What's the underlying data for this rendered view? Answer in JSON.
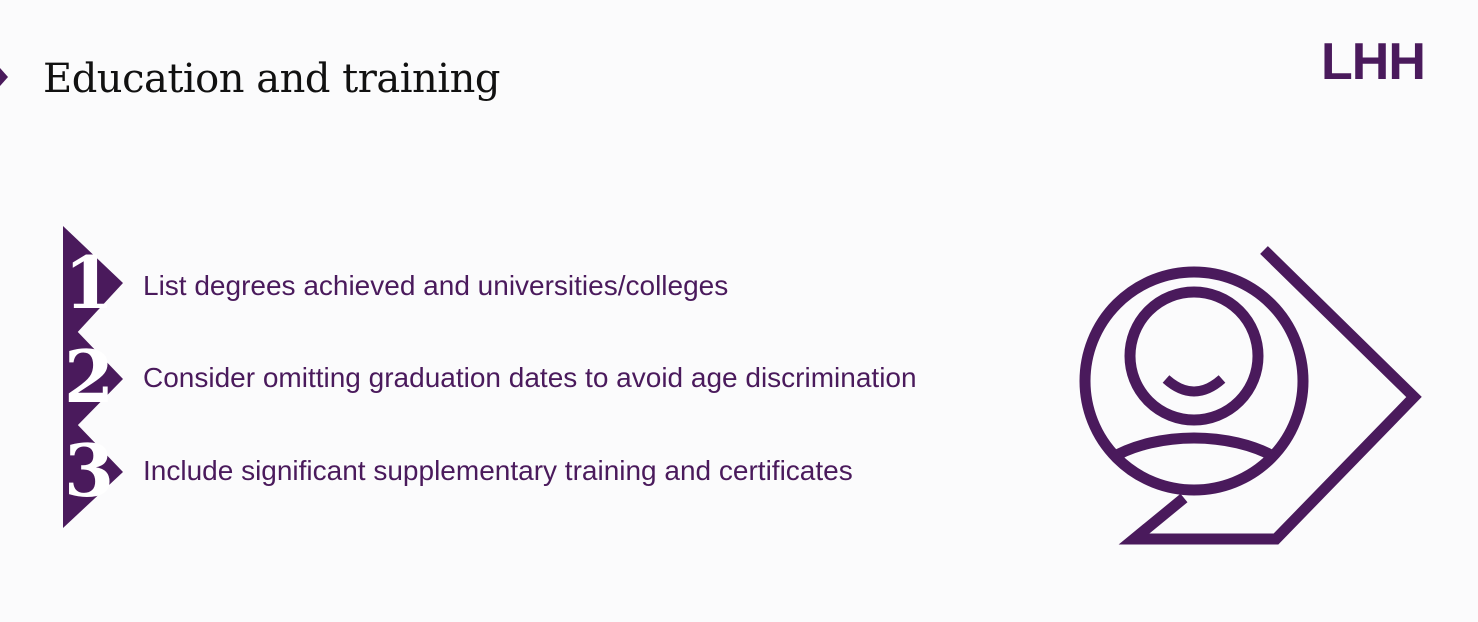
{
  "slide": {
    "title": "Education and training",
    "logo_text": "LHH",
    "numbers": [
      "1",
      "2",
      "3"
    ],
    "items": [
      "List degrees achieved and universities/colleges",
      "Consider omitting graduation dates to avoid age discrimination",
      "Include significant supplementary training and certificates"
    ],
    "illustration_icon": "person-chevron-icon"
  },
  "colors": {
    "brand_purple": "#4a1a5c",
    "title_text": "#111111",
    "background": "#fbfbfc"
  }
}
